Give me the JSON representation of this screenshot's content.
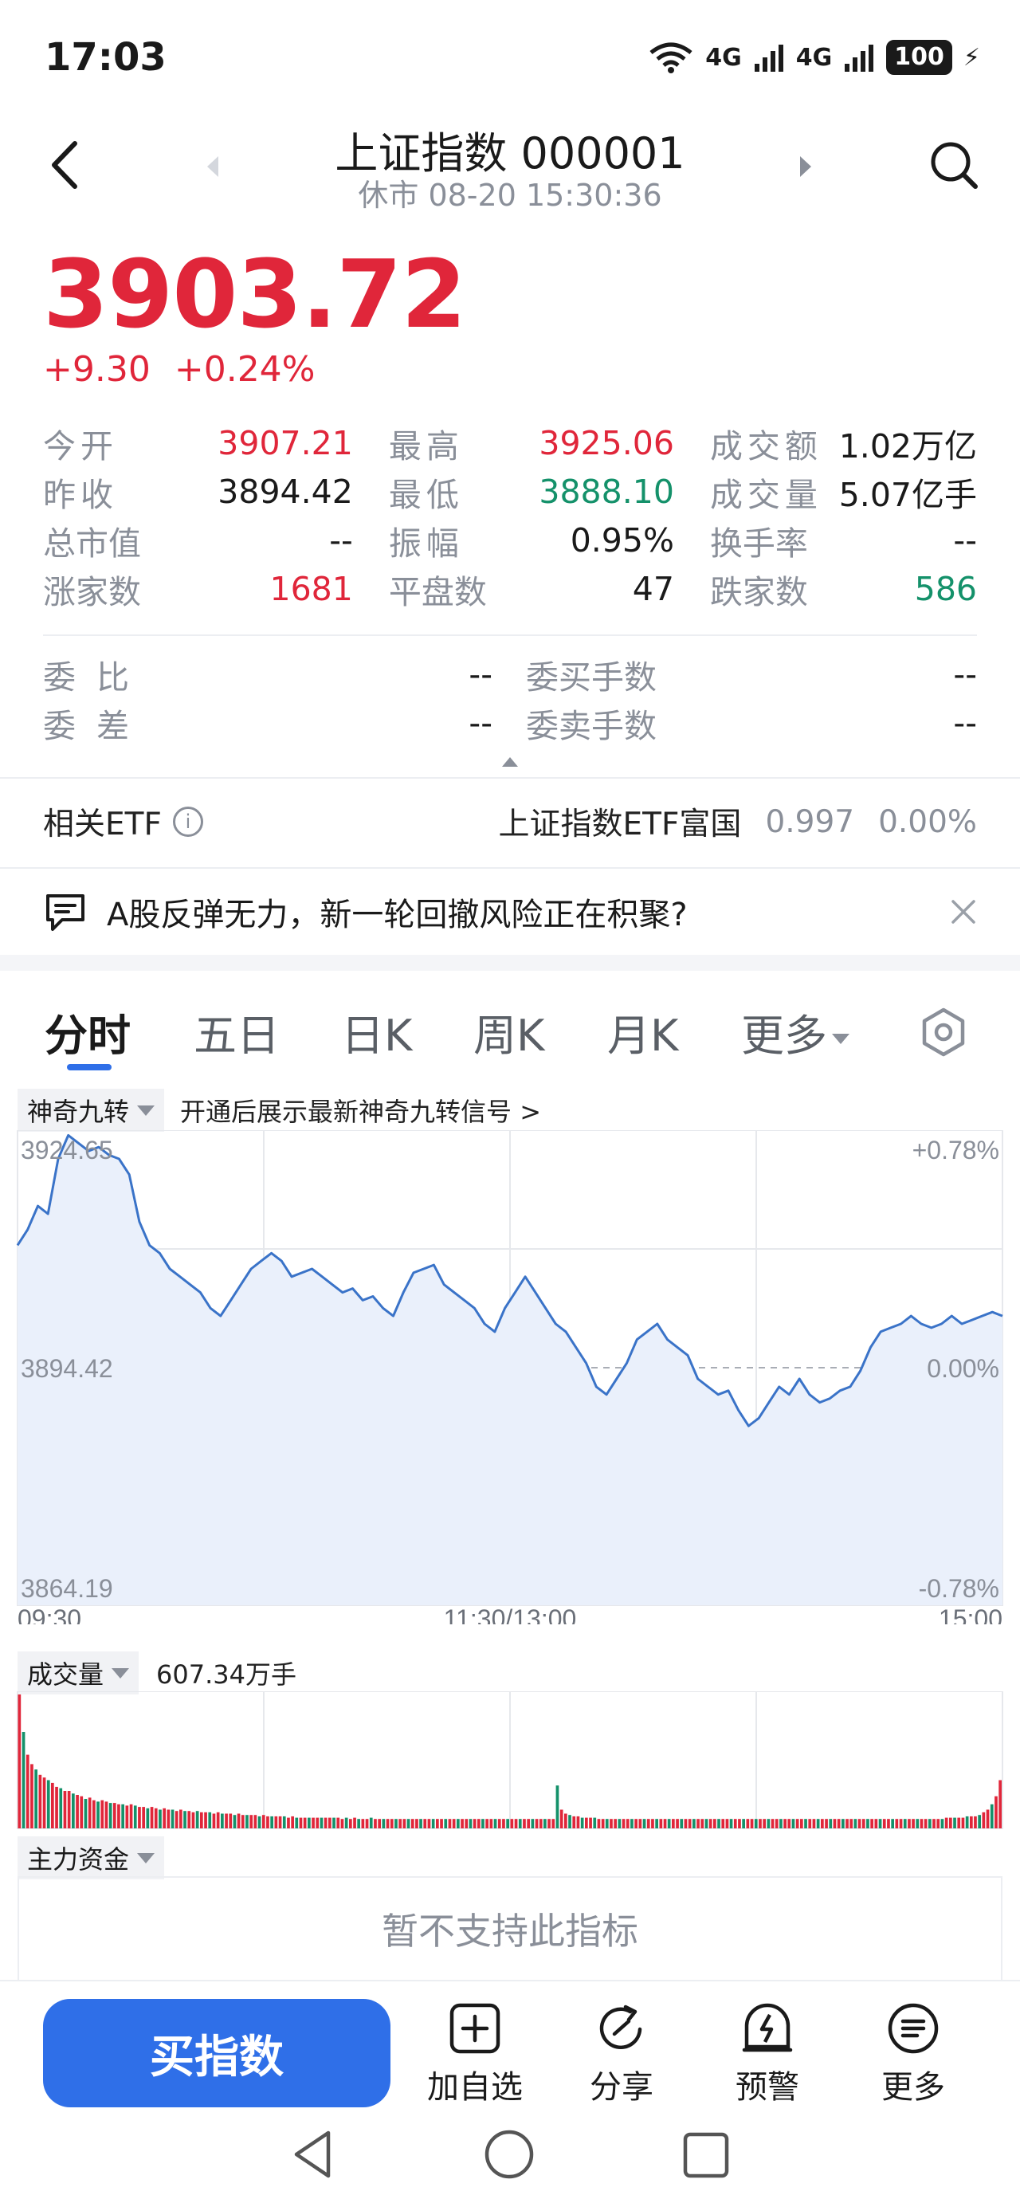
{
  "status": {
    "time": "17:03",
    "net1": "4G",
    "net2": "4G",
    "battery": "100"
  },
  "header": {
    "title": "上证指数 000001",
    "subtitle": "休市 08-20 15:30:36"
  },
  "quote": {
    "price": "3903.72",
    "change": "+9.30",
    "change_pct": "+0.24%"
  },
  "stats": [
    {
      "l1": "今开",
      "v1": "3907.21",
      "l2": "最高",
      "v2": "3925.06",
      "l3": "成交额",
      "v3": "1.02万亿"
    },
    {
      "l1": "昨收",
      "v1": "3894.42",
      "l2": "最低",
      "v2": "3888.10",
      "l3": "成交量",
      "v3": "5.07亿手"
    },
    {
      "l1": "总市值",
      "v1": "--",
      "l2": "振幅",
      "v2": "0.95%",
      "l3": "换手率",
      "v3": "--"
    },
    {
      "l1": "涨家数",
      "v1": "1681",
      "l2": "平盘数",
      "v2": "47",
      "l3": "跌家数",
      "v3": "586"
    }
  ],
  "orders": [
    {
      "l1": "委比",
      "v1": "--",
      "l2": "委买手数",
      "v2": "--"
    },
    {
      "l1": "委差",
      "v1": "--",
      "l2": "委卖手数",
      "v2": "--"
    }
  ],
  "etf": {
    "label": "相关ETF",
    "name": "上证指数ETF富国",
    "price": "0.997",
    "pct": "0.00%"
  },
  "banner": {
    "text": "A股反弹无力，新一轮回撤风险正在积聚?"
  },
  "tabs": [
    "分时",
    "五日",
    "日K",
    "周K",
    "月K",
    "更多"
  ],
  "indicator": {
    "name": "神奇九转",
    "hint": "开通后展示最新神奇九转信号 >"
  },
  "volume": {
    "label": "成交量",
    "value": "607.34万手"
  },
  "capital": {
    "label": "主力资金",
    "message": "暂不支持此指标"
  },
  "bottom": {
    "buy": "买指数",
    "tools": [
      "加自选",
      "分享",
      "预警",
      "更多"
    ]
  },
  "chart_data": {
    "type": "line",
    "y_labels": {
      "top": "3924.65",
      "mid": "3894.42",
      "bottom": "3864.19"
    },
    "pct_labels": {
      "top": "+0.78%",
      "mid": "0.00%",
      "bottom": "-0.78%"
    },
    "x_labels": [
      "09:30",
      "11:30/13:00",
      "15:00"
    ],
    "ylim": [
      3864.19,
      3924.65
    ],
    "baseline": 3894.42,
    "values": [
      3910,
      3912,
      3915,
      3914,
      3921,
      3924,
      3923,
      3922,
      3922.5,
      3921.5,
      3921,
      3919,
      3913,
      3910,
      3909,
      3907,
      3906,
      3905,
      3904,
      3902,
      3901,
      3903,
      3905,
      3907,
      3908,
      3909,
      3908,
      3906,
      3906.5,
      3907,
      3906,
      3905,
      3904,
      3904.5,
      3903,
      3903.5,
      3902,
      3901,
      3904,
      3906.5,
      3907,
      3907.5,
      3905,
      3904,
      3903,
      3902,
      3900,
      3899,
      3902,
      3904,
      3906,
      3904,
      3902,
      3900,
      3899,
      3897,
      3895,
      3892,
      3891,
      3893,
      3895,
      3898,
      3899,
      3900,
      3898,
      3897,
      3896,
      3893,
      3892,
      3891,
      3891.5,
      3889,
      3887,
      3888,
      3890,
      3892,
      3891,
      3893,
      3891,
      3890,
      3890.5,
      3891.5,
      3892,
      3894,
      3897,
      3899,
      3899.5,
      3900,
      3901,
      3900,
      3899.5,
      3900,
      3901,
      3900,
      3900.5,
      3901,
      3901.5,
      3901
    ],
    "volume_bars": [
      100,
      72,
      55,
      48,
      44,
      40,
      38,
      36,
      34,
      31,
      30,
      28,
      28,
      26,
      25,
      24,
      22,
      23,
      21,
      20,
      21,
      20,
      19,
      19,
      18,
      18,
      17,
      18,
      17,
      16,
      16,
      15,
      16,
      15,
      14,
      15,
      14,
      14,
      13,
      14,
      13,
      13,
      12,
      13,
      12,
      12,
      12,
      11,
      12,
      11,
      11,
      11,
      10,
      11,
      10,
      10,
      10,
      10,
      9,
      10,
      9,
      9,
      9,
      9,
      9,
      8,
      9,
      8,
      8,
      8,
      8,
      8,
      8,
      8,
      8,
      8,
      8,
      8,
      7,
      8,
      7,
      8,
      7,
      7,
      7,
      8,
      7,
      7,
      7,
      7,
      7,
      7,
      7,
      7,
      7,
      7,
      7,
      7,
      7,
      7,
      7,
      7,
      7,
      7,
      7,
      7,
      7,
      7,
      7,
      7,
      7,
      7,
      7,
      7,
      7,
      7,
      7,
      7,
      7,
      7,
      7,
      7,
      7,
      7,
      7,
      7,
      7,
      7,
      7,
      7,
      32,
      14,
      11,
      10,
      9,
      9,
      8,
      8,
      8,
      8,
      7,
      7,
      7,
      7,
      7,
      7,
      7,
      7,
      7,
      7,
      7,
      7,
      7,
      7,
      7,
      7,
      7,
      7,
      7,
      7,
      7,
      7,
      7,
      7,
      7,
      7,
      7,
      7,
      7,
      7,
      7,
      7,
      7,
      7,
      7,
      7,
      7,
      7,
      7,
      7,
      7,
      7,
      7,
      7,
      7,
      7,
      7,
      7,
      7,
      7,
      7,
      7,
      7,
      7,
      7,
      7,
      7,
      7,
      7,
      7,
      7,
      7,
      7,
      7,
      7,
      7,
      7,
      7,
      7,
      7,
      7,
      7,
      7,
      7,
      7,
      7,
      7,
      7,
      7,
      7,
      7,
      7,
      7,
      7,
      8,
      8,
      8,
      8,
      8,
      9,
      9,
      9,
      10,
      12,
      14,
      18,
      24,
      36
    ],
    "colors": {
      "line": "#3a73c8",
      "fill": "#eaf0fb",
      "up": "#e0263a",
      "down": "#14916a",
      "grid": "#e6e8ec"
    }
  }
}
